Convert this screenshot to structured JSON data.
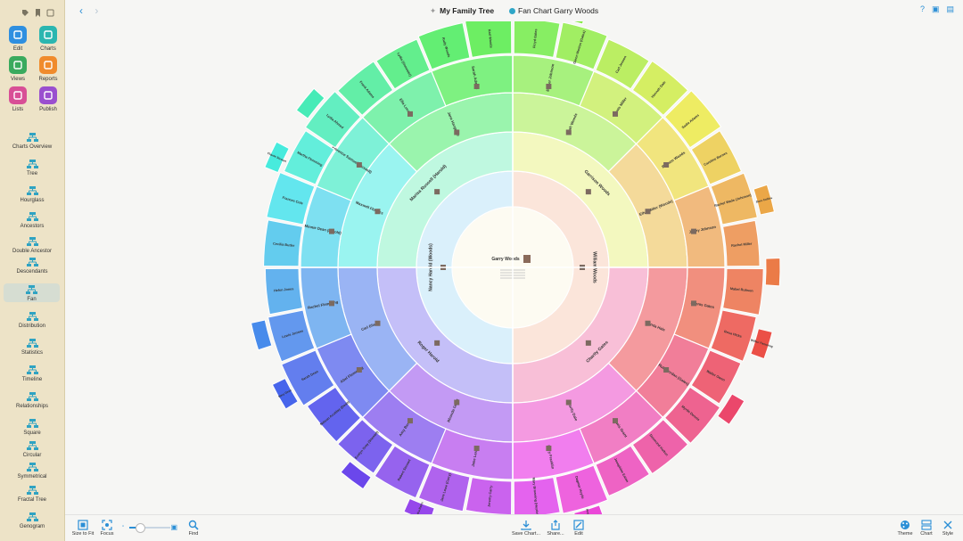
{
  "window": {
    "document_title": "My Family Tree",
    "chart_title": "Fan Chart Garry Woods"
  },
  "sidebar": {
    "tools": [
      {
        "label": "Edit",
        "icon": "pencil-icon",
        "color": "#2f8fe0"
      },
      {
        "label": "Charts",
        "icon": "charts-icon",
        "color": "#2bb6b0"
      },
      {
        "label": "Views",
        "icon": "eye-icon",
        "color": "#3aaa5e"
      },
      {
        "label": "Reports",
        "icon": "reports-icon",
        "color": "#f08b2c"
      },
      {
        "label": "Lists",
        "icon": "lists-icon",
        "color": "#d84f96"
      },
      {
        "label": "Publish",
        "icon": "publish-icon",
        "color": "#9a4fcf"
      }
    ],
    "chart_types": [
      {
        "label": "Charts Overview",
        "icon": "charts-overview-icon"
      },
      {
        "label": "Tree",
        "icon": "tree-icon"
      },
      {
        "label": "Hourglass",
        "icon": "hourglass-icon"
      },
      {
        "label": "Ancestors",
        "icon": "ancestors-icon"
      },
      {
        "label": "Double Ancestor",
        "icon": "double-ancestor-icon"
      },
      {
        "label": "Descendants",
        "icon": "descendants-icon"
      },
      {
        "label": "Fan",
        "icon": "fan-icon",
        "selected": true
      },
      {
        "label": "Distribution",
        "icon": "distribution-icon"
      },
      {
        "label": "Statistics",
        "icon": "statistics-icon"
      },
      {
        "label": "Timeline",
        "icon": "timeline-icon"
      },
      {
        "label": "Relationships",
        "icon": "relationships-icon"
      },
      {
        "label": "Square",
        "icon": "square-icon"
      },
      {
        "label": "Circular",
        "icon": "circular-icon"
      },
      {
        "label": "Symmetrical",
        "icon": "symmetrical-icon"
      },
      {
        "label": "Fractal Tree",
        "icon": "fractal-tree-icon"
      },
      {
        "label": "Genogram",
        "icon": "genogram-icon"
      }
    ]
  },
  "bottombar": {
    "size_to_fit": "Size to Fit",
    "focus": "Focus",
    "find": "Find",
    "save_chart": "Save Chart...",
    "share": "Share...",
    "edit": "Edit",
    "theme": "Theme",
    "chart": "Chart",
    "style": "Style",
    "zoom_fraction": 0.25
  },
  "fan": {
    "center_person": "Garry Woods",
    "generation_1": [
      "William Woods",
      "Nancy Harold (Woods)"
    ],
    "generation_2": [
      "Garrison Woods",
      "Charity Gates",
      "Roger Harold",
      "Marisa Russell (Harold)"
    ],
    "generation_3": [
      "Noah Woods",
      "Ethel Miller (Woods)",
      "Linda Hale",
      "Charity Dale",
      "Rhonda Grant",
      "Carl Elise",
      "Maxwell Flowers",
      "Jane Hargrove"
    ],
    "generation_4": [
      "Esther Johnson",
      "Lewis Miller",
      "Benson Woods",
      "Jenny Johnson",
      "Dennis Gates",
      "Ruth Jordan (Gates)",
      "Lewis Grant",
      "Mary Franklin",
      "Jane Leroy",
      "Amy Berry",
      "Abel Flemming",
      "Rachel Flemming",
      "Minnie Dean (Harold)",
      "Florence Samuel (Russell)",
      "Ella Lucas",
      "Sarah Adams"
    ],
    "generation_5": [
      "Floyd Gates",
      "Glenn Morton (Gates)",
      "Carl Jensen",
      "Hannah Dale",
      "Sadie Adams",
      "Caroline Barnes",
      "Rachel Wade (Johnson)",
      "Rachel Miller",
      "Mabel Robson",
      "Rosa Hicks",
      "Walter Owen",
      "Myrtle Dennis",
      "Desmond Holton",
      "Josephine Eaton",
      "Dagmar Heyde",
      "Mary Browning (Heyde)",
      "Jeremy Carry",
      "Jane Lowe (Carry)",
      "Robert Stewart",
      "Evelyn Gray (Stewart)",
      "Nelson Aculday (Dean)",
      "Sarah Dean",
      "Lewis Jensen",
      "Helen Jones",
      "Cecilia Butler",
      "Frances Cole",
      "Martha Flemming",
      "Lydia Ahmed",
      "Frank Adams",
      "Lydia (Gonzalez)",
      "Rudy Woods",
      "Karl Woods"
    ],
    "generation_6": [
      "Bernard Flemming",
      "Samuel Adams",
      "Dora Collins",
      "Wilbur Flemming",
      "Roy Harold",
      "Bertha Bates",
      "Mary Dean",
      "Claude Stewart"
    ]
  }
}
